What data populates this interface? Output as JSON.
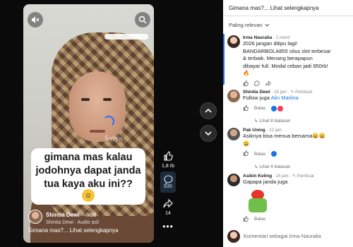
{
  "video": {
    "watermark": "Satya",
    "caption_lines": [
      "gimana mas kalau",
      "jodohnya dapat janda",
      "tua kaya aku ini??"
    ],
    "author": {
      "name": "Shintia Dewi",
      "follow": "· Ikuti",
      "audio": "Shintia Dewi · Audio asli"
    },
    "description": "Gimana mas?... Lihat selengkapnya"
  },
  "actions": {
    "likes": "1,8 rb",
    "comments": "635",
    "shares": "14"
  },
  "panel": {
    "title": "Gimana mas?... Lihat selengkapnya",
    "sort": "Paling relevan",
    "comments": [
      {
        "name": "Irma Nauralia",
        "meta": "· 1 menit",
        "lines": [
          "2026 jangan ditipu lagi!",
          "BANDARBOLA855 situs slot terbesar",
          "& terbaik. Menang berapapun",
          "dibayar full. Modal ceban jadi 950rb!",
          "🔥"
        ],
        "actions": [
          "Suka",
          "Balas"
        ]
      },
      {
        "name": "Shintia Dewi",
        "meta": "· 16 jam · ✎ Pembuat",
        "text": "Follow juga ",
        "link": "Alin Marlina",
        "reply": "Balas",
        "replies": "Lihat 8 balasan"
      },
      {
        "name": "Pak Uning",
        "meta": "· 22 jam",
        "text": "Asiknya bisa menua bersama😀😀",
        "emoji": "😀",
        "reply": "Balas",
        "replies": "Lihat 4 balasan"
      },
      {
        "name": "Asikin Keling",
        "meta": "· 14 jam · ✎ Pembuat",
        "text": "Gapapa janda juga",
        "reply": "Balas"
      }
    ],
    "input_placeholder": "Komentari sebagai Irma Nauralia"
  },
  "colors": {
    "accent": "#1b74e4",
    "panel_bg": "#ffffff",
    "page_bg": "#0a0a0a"
  }
}
